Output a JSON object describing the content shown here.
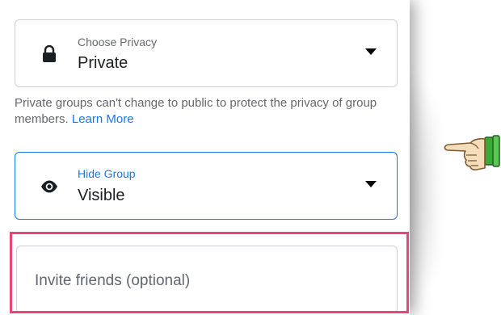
{
  "privacy": {
    "label": "Choose Privacy",
    "value": "Private",
    "icon": "lock-icon"
  },
  "helper": {
    "text": "Private groups can't change to public to protect the privacy of group members. ",
    "link": "Learn More"
  },
  "hide_group": {
    "label": "Hide Group",
    "value": "Visible",
    "icon": "eye-icon",
    "accent": "#1877f2"
  },
  "invite": {
    "placeholder": "Invite friends (optional)",
    "highlight_color": "#e8457b"
  },
  "pointer": {
    "icon": "pointing-hand-icon"
  }
}
